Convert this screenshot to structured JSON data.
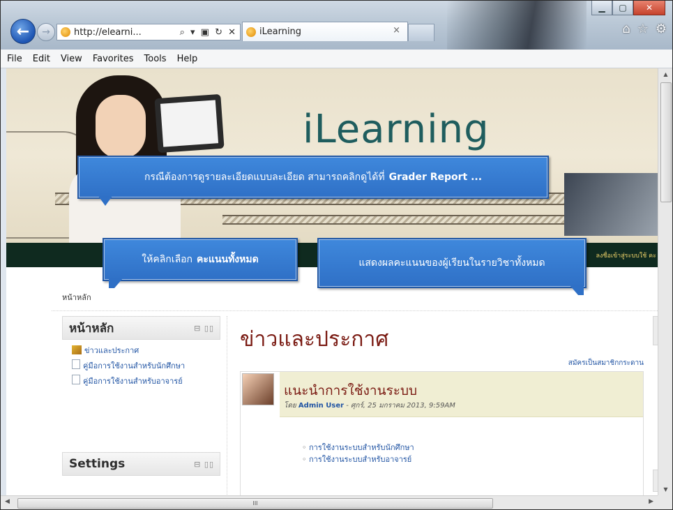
{
  "browser": {
    "address_url": "http://elearni...",
    "address_tools": "⌕ ▾ ▣ ↻ ✕",
    "tab_title": "iLearning",
    "tab_close": "×",
    "window_buttons": {
      "minimize": "▁",
      "maximize": "▢",
      "close": "✕"
    },
    "toolbar_icons": {
      "home": "⌂",
      "favorites": "☆",
      "settings": "⚙"
    }
  },
  "menu": {
    "items": [
      "File",
      "Edit",
      "View",
      "Favorites",
      "Tools",
      "Help"
    ]
  },
  "banner": {
    "logo": "iLearning",
    "stripe_link": "ลงชื่อเข้าสู่ระบบใช้ คะ"
  },
  "breadcrumb": "หน้าหลัก",
  "sidebar": {
    "home_block": {
      "title": "หน้าหลัก",
      "controls": "⊟ ▯▯",
      "items": [
        "ข่าวและประกาศ",
        "คู่มือการใช้งานสำหรับนักศึกษา",
        "คู่มือการใช้งานสำหรับอาจารย์"
      ]
    },
    "settings_block": {
      "title": "Settings",
      "controls": "⊟ ▯▯"
    }
  },
  "main": {
    "title": "ข่าวและประกาศ",
    "subscribe": "สมัครเป็นสมาชิกกระดาน",
    "post": {
      "title": "แนะนำการใช้งานระบบ",
      "meta_prefix": "โดย",
      "author": "Admin User",
      "meta_suffix": "- ศุกร์, 25 มกราคม 2013, 9:59AM",
      "links": [
        "การใช้งานระบบสำหรับนักศึกษา",
        "การใช้งานระบบสำหรับอาจารย์"
      ]
    }
  },
  "callouts": {
    "c1": {
      "text": "กรณีต้องการดูรายละเอียดแบบละเอียด สามารถคลิกดูได้ที่",
      "bold": "Grader Report ..."
    },
    "c2": {
      "text": "ให้คลิกเลือก",
      "bold": "คะแนนทั้งหมด"
    },
    "c3": {
      "text": "แสดงผลคะแนนของผู้เรียนในรายวิชาทั้งหมด"
    }
  },
  "hscroll_grip": "III"
}
